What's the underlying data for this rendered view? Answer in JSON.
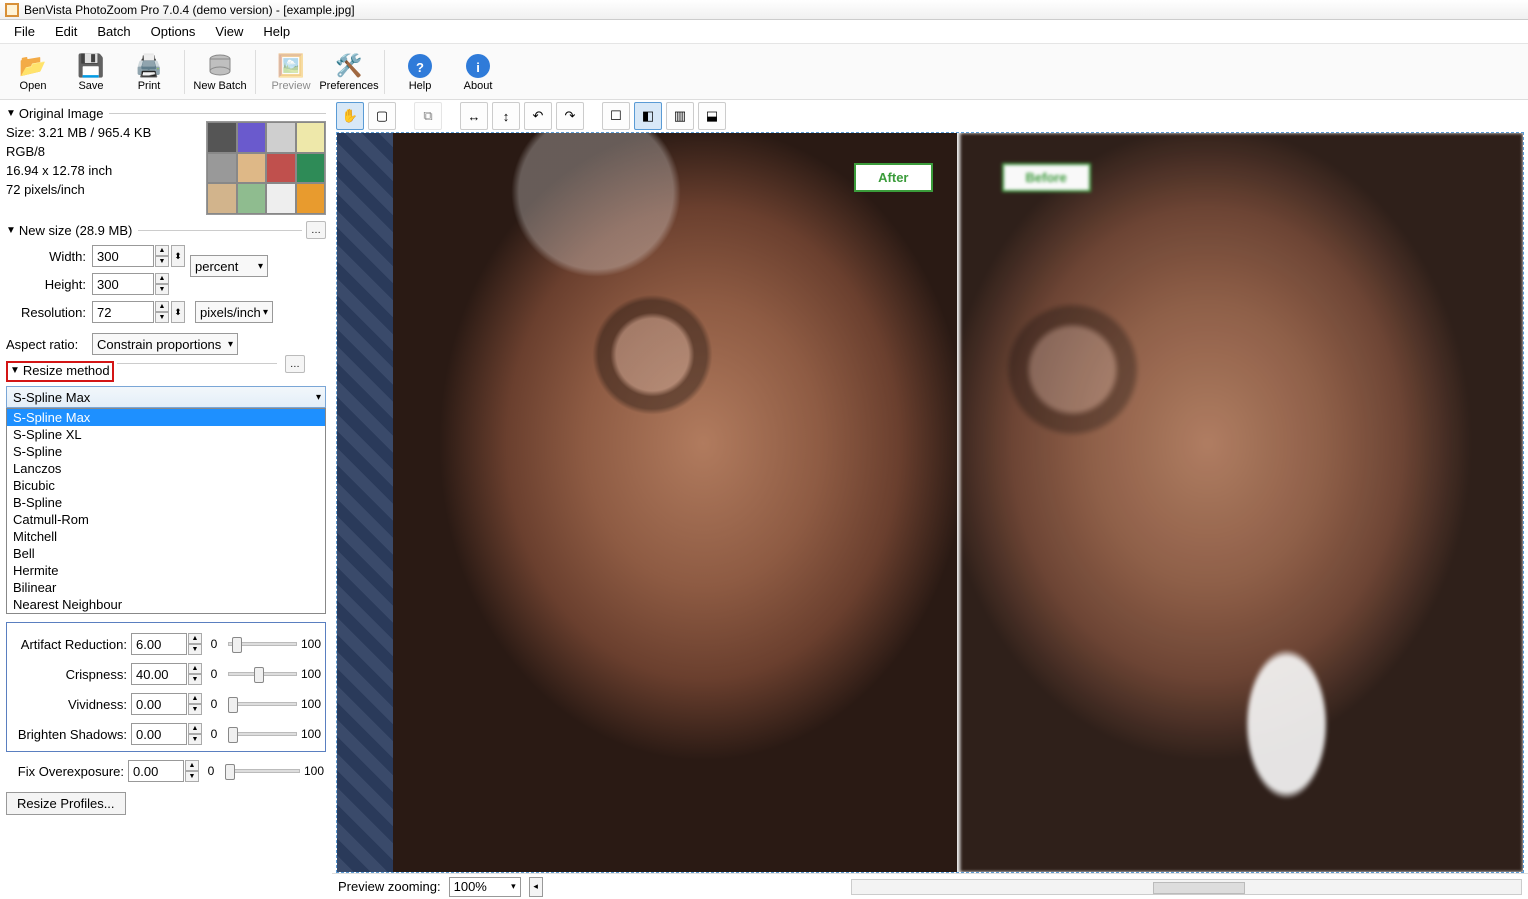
{
  "title": "BenVista PhotoZoom Pro 7.0.4 (demo version) - [example.jpg]",
  "menu": {
    "file": "File",
    "edit": "Edit",
    "batch": "Batch",
    "options": "Options",
    "view": "View",
    "help": "Help"
  },
  "toolbar": {
    "open": "Open",
    "save": "Save",
    "print": "Print",
    "newbatch": "New Batch",
    "preview": "Preview",
    "preferences": "Preferences",
    "help": "Help",
    "about": "About"
  },
  "orig": {
    "header": "Original Image",
    "size": "Size: 3.21 MB / 965.4 KB",
    "mode": "RGB/8",
    "dim": "16.94 x 12.78 inch",
    "res": "72 pixels/inch"
  },
  "newsize": {
    "header": "New size (28.9 MB)",
    "width_lbl": "Width:",
    "width": "300",
    "height_lbl": "Height:",
    "height": "300",
    "res_lbl": "Resolution:",
    "res": "72",
    "unit_percent": "percent",
    "unit_res": "pixels/inch",
    "aspect_lbl": "Aspect ratio:",
    "aspect": "Constrain proportions"
  },
  "resize": {
    "header": "Resize method",
    "selected": "S-Spline Max",
    "options": [
      "S-Spline Max",
      "S-Spline XL",
      "S-Spline",
      "Lanczos",
      "Bicubic",
      "B-Spline",
      "Catmull-Rom",
      "Mitchell",
      "Bell",
      "Hermite",
      "Bilinear",
      "Nearest Neighbour"
    ]
  },
  "sliders": {
    "artifact": {
      "lbl": "Artifact Reduction:",
      "val": "6.00",
      "min": "0",
      "max": "100",
      "pos": 6
    },
    "crisp": {
      "lbl": "Crispness:",
      "val": "40.00",
      "min": "0",
      "max": "100",
      "pos": 40
    },
    "vivid": {
      "lbl": "Vividness:",
      "val": "0.00",
      "min": "0",
      "max": "100",
      "pos": 0
    },
    "brighten": {
      "lbl": "Brighten Shadows:",
      "val": "0.00",
      "min": "0",
      "max": "100",
      "pos": 0
    },
    "overexp": {
      "lbl": "Fix Overexposure:",
      "val": "0.00",
      "min": "0",
      "max": "100",
      "pos": 0
    }
  },
  "profiles_btn": "Resize Profiles...",
  "preview": {
    "after": "After",
    "before": "Before"
  },
  "status": {
    "preview_zoom_lbl": "Preview zooming:",
    "zoom": "100%"
  }
}
